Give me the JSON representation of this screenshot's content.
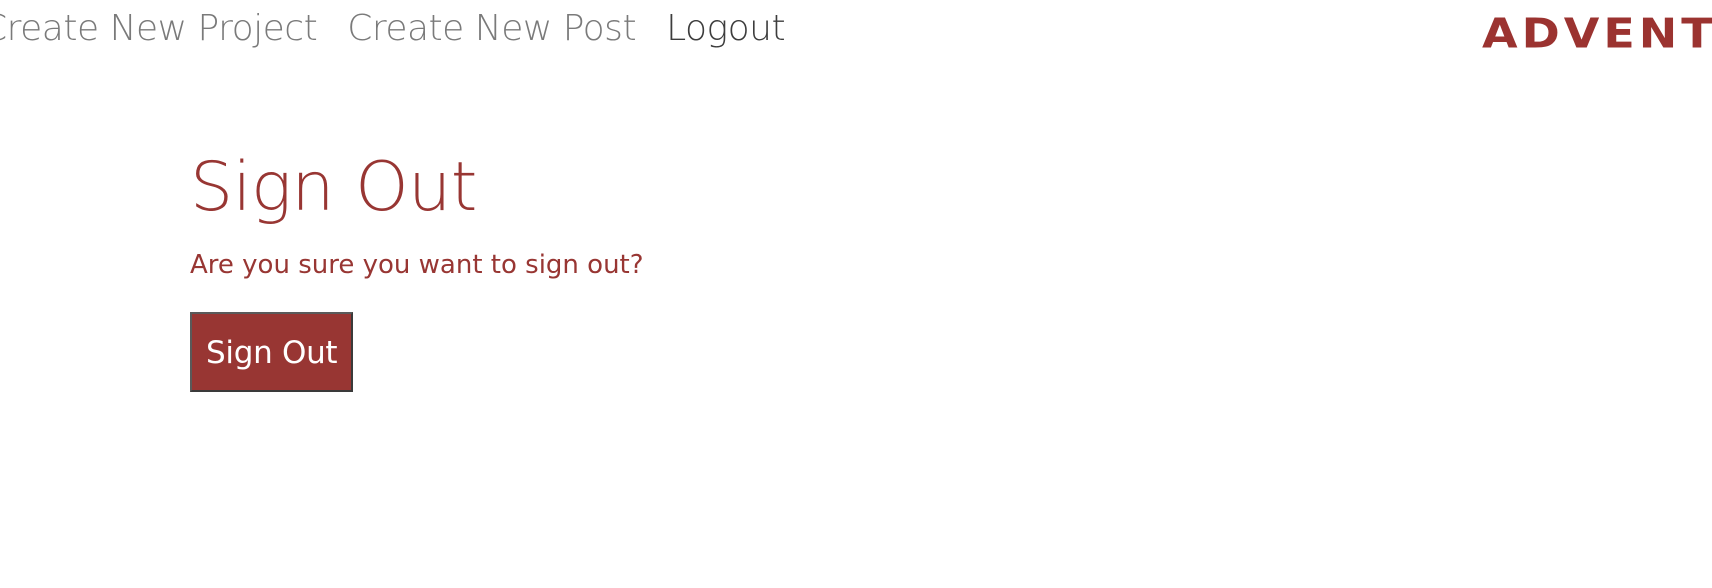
{
  "nav": {
    "items": [
      {
        "label": "Create New Project"
      },
      {
        "label": "Create New Post"
      },
      {
        "label": "Logout"
      }
    ],
    "brand": "ADVENT"
  },
  "main": {
    "title": "Sign Out",
    "prompt": "Are you sure you want to sign out?",
    "button_label": "Sign Out"
  },
  "colors": {
    "accent": "#983633",
    "nav_text": "#7a7a7a",
    "nav_active": "#3d3d3d"
  }
}
